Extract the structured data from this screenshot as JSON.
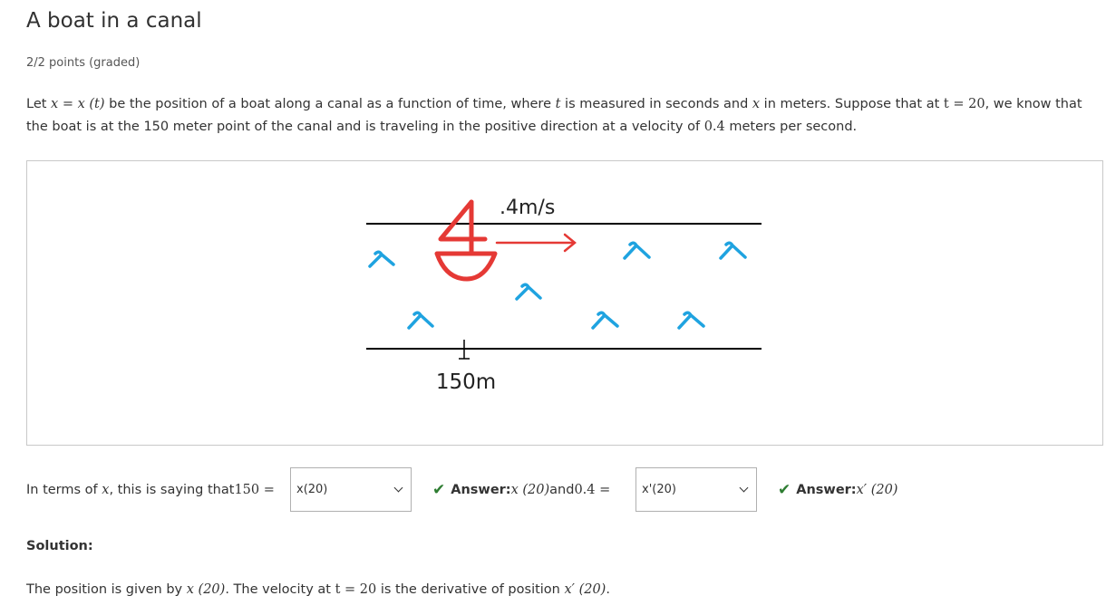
{
  "title": "A boat in a canal",
  "points": "2/2 points (graded)",
  "problem": {
    "t1": "Let ",
    "m1": "x = x (t)",
    "t2": " be the position of a boat along a canal as a function of time, where ",
    "m2": "t",
    "t3": " is measured in seconds and ",
    "m3": "x",
    "t4": " in meters. Suppose that at ",
    "m4": "t = 20",
    "t5": ", we know that the boat is at the 150 meter point of the canal and is traveling in the positive direction at a velocity of ",
    "m5": "0.4",
    "t6": " meters per second."
  },
  "figure": {
    "velocity_label": ".4m/s",
    "position_label": "150m",
    "colors": {
      "boat": "#e53935",
      "wave": "#1fa3e0",
      "line": "#000000"
    }
  },
  "question": {
    "t1": "In terms of ",
    "m1": "x",
    "t2": ", this is saying that ",
    "m2": "150 =",
    "select1_value": "x(20)",
    "answer1_label": "Answer: ",
    "answer1_math": "x (20)",
    "t3": " and ",
    "m3": "0.4 =",
    "select2_value": "x'(20)",
    "answer2_label": "Answer: ",
    "answer2_math": "x′ (20)"
  },
  "solution": {
    "label": "Solution:",
    "t1": "The position is given by ",
    "m1": "x (20)",
    "t2": ". The velocity at ",
    "m2": "t = 20",
    "t3": " is the derivative of position ",
    "m3": "x′ (20)",
    "t4": "."
  }
}
